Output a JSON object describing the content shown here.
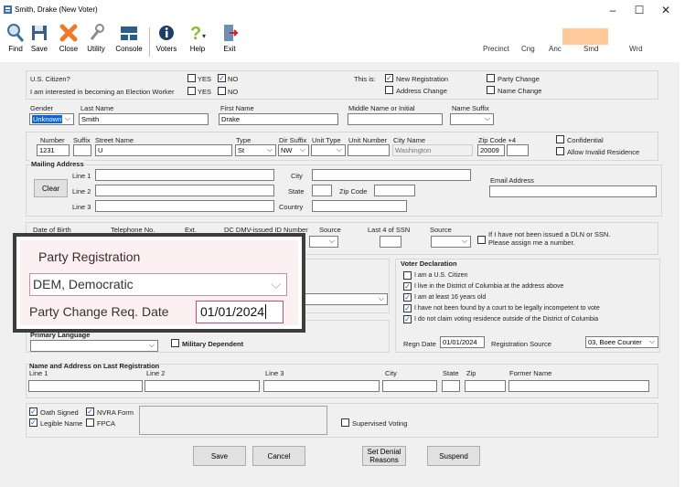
{
  "window": {
    "title": "Smith, Drake (New Voter)",
    "minimize": "–",
    "maximize": "☐",
    "close": "✕"
  },
  "toolbar": {
    "find": "Find",
    "save": "Save",
    "close": "Close",
    "utility": "Utility",
    "console": "Console",
    "voters": "Voters",
    "help": "Help",
    "exit": "Exit",
    "precinct": "Precinct",
    "cng": "Cng",
    "anc": "Anc",
    "smd": "Smd",
    "wrd": "Wrd"
  },
  "citizen": {
    "question": "U.S. Citizen?",
    "yes": "YES",
    "no": "NO",
    "worker_question": "I am interested in becoming an Election Worker",
    "this_is": "This is:",
    "new_registration": "New Registration",
    "address_change": "Address Change",
    "party_change": "Party Change",
    "name_change": "Name Change"
  },
  "name": {
    "gender_label": "Gender",
    "gender_value": "Unknown",
    "last_label": "Last Name",
    "last_value": "Smith",
    "first_label": "First Name",
    "first_value": "Drake",
    "middle_label": "Middle Name or Initial",
    "suffix_label": "Name Suffix"
  },
  "address": {
    "number_label": "Number",
    "number_value": "1231",
    "suffix_label": "Suffix",
    "street_label": "Street Name",
    "street_value": "U",
    "type_label": "Type",
    "type_value": "St",
    "dir_label": "Dir Suffix",
    "dir_value": "NW",
    "unittype_label": "Unit Type",
    "unitnum_label": "Unit Number",
    "city_label": "City Name",
    "city_value": "Washington",
    "zip_label": "Zip Code +4",
    "zip_value": "20009",
    "confidential": "Confidential",
    "invalid": "Allow Invalid Residence"
  },
  "mailing": {
    "title": "Mailing Address",
    "clear": "Clear",
    "line1": "Line 1",
    "line2": "Line 2",
    "line3": "Line 3",
    "city": "City",
    "state": "State",
    "zip": "Zip Code",
    "country": "Country",
    "email": "Email Address"
  },
  "dob": {
    "dob_label": "Date of Birth",
    "phone_label": "Telephone No.",
    "ext_label": "Ext.",
    "dmv_label": "DC DMV-issued ID Number",
    "source_label": "Source",
    "ssn_label": "Last 4 of SSN",
    "source2_label": "Source",
    "no_dln": "If I have not been issued a DLN or SSN. Please assign me a number."
  },
  "declaration": {
    "title": "Voter Declaration",
    "items": [
      {
        "label": "I am a U.S. Citizen",
        "checked": false
      },
      {
        "label": "I live in the District of Columbia at the address above",
        "checked": true
      },
      {
        "label": "I am at least 16 years old",
        "checked": true
      },
      {
        "label": "I have not been found by a court to be legally incompetent to vote",
        "checked": true
      },
      {
        "label": "I do not claim voting residence outside of the District of Columbia",
        "checked": true
      }
    ],
    "regn_label": "Regn Date",
    "regn_value": "01/01/2024",
    "source_label": "Registration Source",
    "source_value": "03, Boee Counter"
  },
  "language": {
    "primary": "Primary Language",
    "military": "Military Dependent"
  },
  "last_reg": {
    "title": "Name and Address on Last Registration",
    "line1": "Line 1",
    "line2": "Line 2",
    "line3": "Line 3",
    "city": "City",
    "state": "State",
    "zip": "Zip",
    "former": "Former Name"
  },
  "oath": {
    "oath": "Oath Signed",
    "nvra": "NVRA Form",
    "legible": "Legible Name",
    "fpca": "FPCA",
    "supervised": "Supervised Voting"
  },
  "buttons": {
    "save": "Save",
    "cancel": "Cancel",
    "denial": "Set Denial Reasons",
    "suspend": "Suspend"
  },
  "overlay": {
    "title": "Party Registration",
    "party_value": "DEM, Democratic",
    "date_label": "Party Change Req. Date",
    "date_value": "01/01/2024"
  },
  "colors": {
    "accent": "#c94a75",
    "smd_box": "#ffc99a",
    "checkmark": "#1a5fb4"
  }
}
